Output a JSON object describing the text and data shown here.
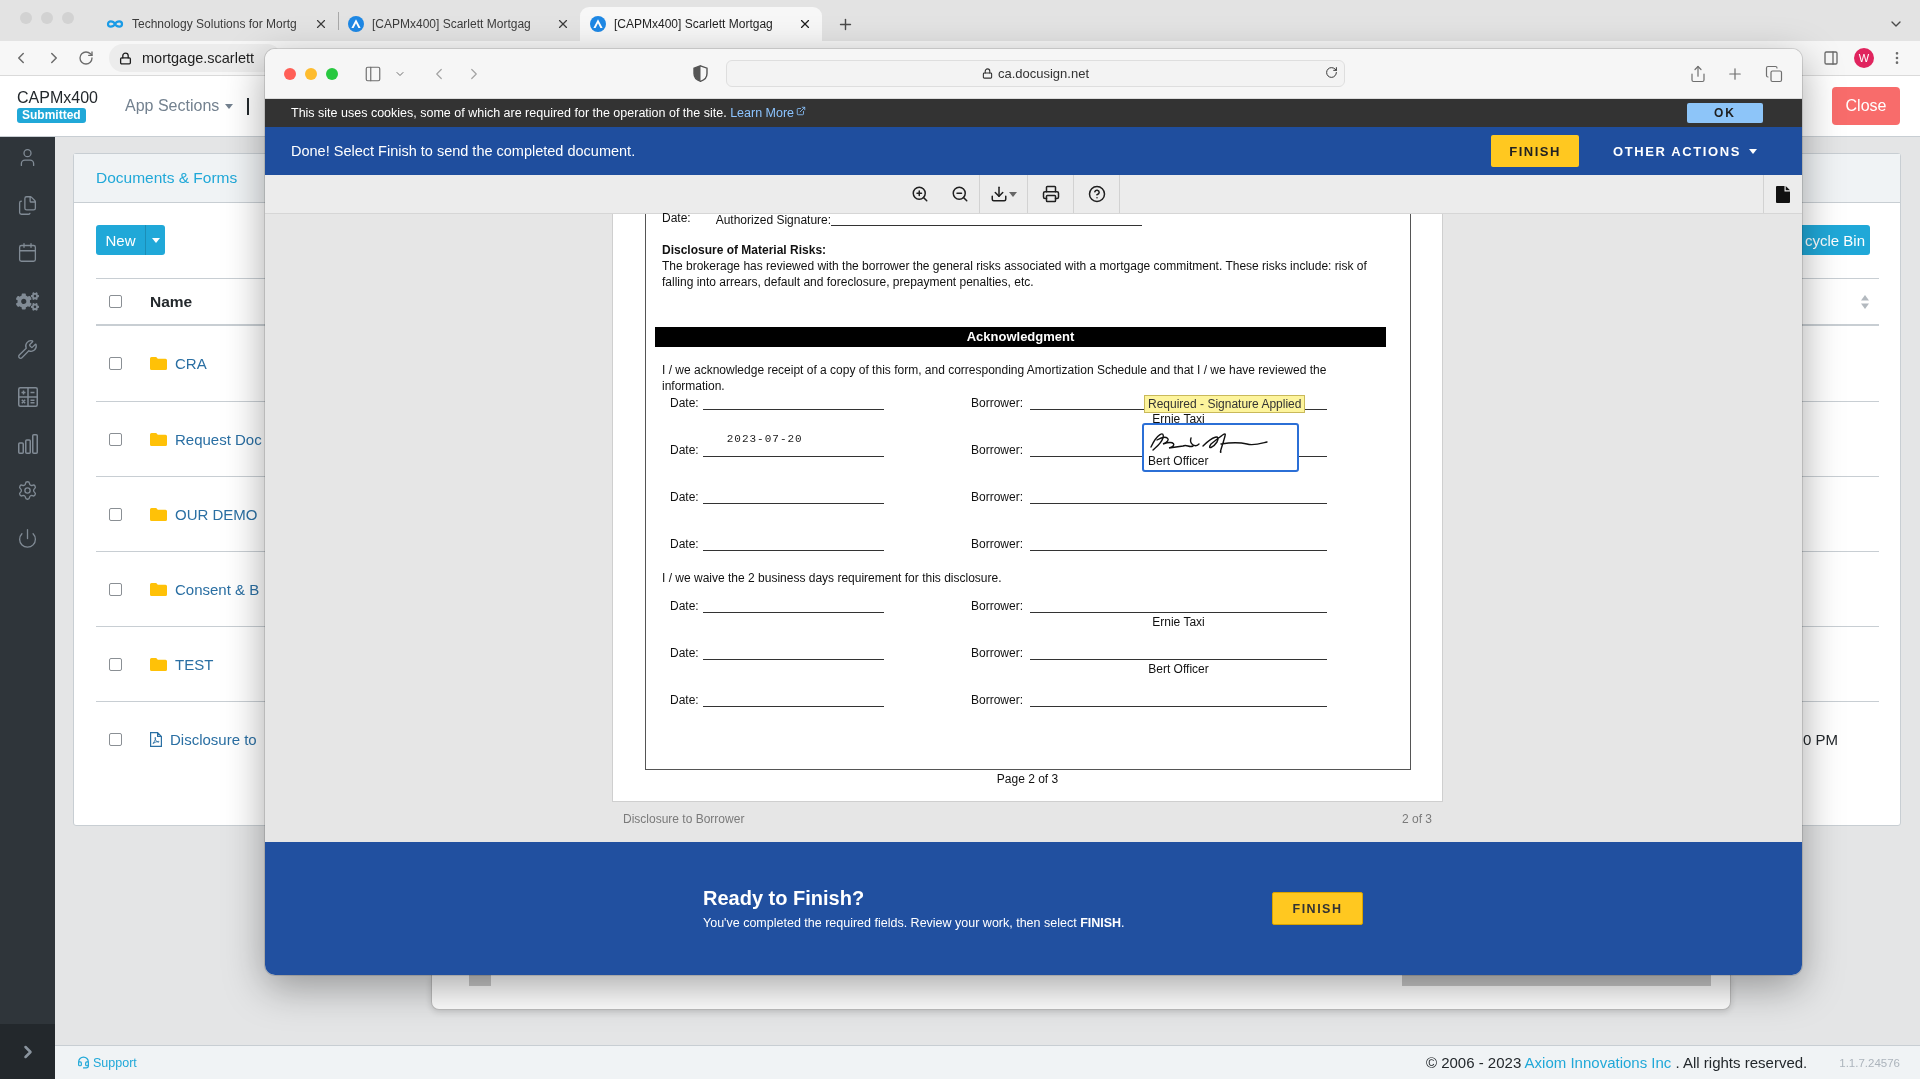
{
  "browser": {
    "tabs": [
      {
        "title": "Technology Solutions for Mortg",
        "kind": "site",
        "selected": false
      },
      {
        "title": "[CAPMx400] Scarlett Mortgag",
        "kind": "app",
        "selected": false
      },
      {
        "title": "[CAPMx400] Scarlett Mortgag",
        "kind": "app",
        "selected": true
      }
    ],
    "url": "mortgage.scarlett",
    "profile": "W"
  },
  "app": {
    "name": "CAPMx400",
    "status": "Submitted",
    "menu": "App Sections",
    "close_button": "Close",
    "panel": {
      "title": "Documents & Forms",
      "new_button": "New",
      "recycle_button": "cycle Bin",
      "table": {
        "all_checked": false,
        "columns": [
          "Name"
        ],
        "rows": [
          {
            "name": "CRA",
            "kind": "folder",
            "checked": false
          },
          {
            "name": "Request Doc",
            "kind": "folder",
            "checked": false
          },
          {
            "name": "OUR DEMO",
            "kind": "folder",
            "checked": false
          },
          {
            "name": "Consent & B",
            "kind": "folder",
            "checked": false
          },
          {
            "name": "TEST",
            "kind": "folder",
            "checked": false
          },
          {
            "name": "Disclosure to",
            "kind": "pdf",
            "checked": false,
            "modified": "0 PM"
          }
        ]
      }
    },
    "footer": {
      "support": "Support",
      "copyright": "© 2006 - 2023",
      "company": "Axiom Innovations Inc",
      "rights": ". All rights reserved.",
      "version": "1.1.7.24576"
    }
  },
  "signing_window": {
    "address": "ca.docusign.net",
    "cookie_notice": {
      "text": "This site uses cookies, some of which are required for the operation of the site.",
      "link": "Learn More",
      "button": "OK"
    },
    "action_bar": {
      "message": "Done! Select Finish to send the completed document.",
      "finish_button": "FINISH",
      "menu": "OTHER ACTIONS"
    },
    "document": {
      "top_line": {
        "date_label": "Date:",
        "signature_label": "Authorized Signature:"
      },
      "risks_title": "Disclosure of Material Risks:",
      "risks_text": "The brokerage has reviewed with the borrower the general risks associated with a mortgage commitment. These risks include: risk of falling into arrears, default and foreclosure, prepayment penalties, etc.",
      "banner": "Acknowledgment",
      "acknowledgment": "I / we acknowledge receipt of a copy of this form, and corresponding Amortization Schedule and that I / we have reviewed the information.",
      "acknowledgment_rows": [
        {
          "kind": "tagged",
          "date_label": "Date:",
          "borrower_label": "Borrower:",
          "tag": "Required - Signature Applied",
          "signer": "Ernie Taxi"
        },
        {
          "kind": "signed",
          "date_label": "Date:",
          "date_value": "2023-07-20",
          "borrower_label": "Borrower:",
          "signer": "Bert Officer"
        },
        {
          "kind": "blank",
          "date_label": "Date:",
          "borrower_label": "Borrower:"
        },
        {
          "kind": "blank",
          "date_label": "Date:",
          "borrower_label": "Borrower:"
        }
      ],
      "waiver": "I / we waive the 2 business days requirement for this disclosure.",
      "waiver_rows": [
        {
          "kind": "named",
          "date_label": "Date:",
          "borrower_label": "Borrower:",
          "signer": "Ernie Taxi"
        },
        {
          "kind": "named",
          "date_label": "Date:",
          "borrower_label": "Borrower:",
          "signer": "Bert Officer"
        },
        {
          "kind": "blank",
          "date_label": "Date:",
          "borrower_label": "Borrower:"
        }
      ],
      "page_label": "Page 2 of 3"
    },
    "document_name": "Disclosure to Borrower",
    "page_count": "2 of 3",
    "finish_panel": {
      "title": "Ready to Finish?",
      "text": "You've completed the required fields. Review your work, then select **FINISH**.",
      "button": "FINISH"
    }
  }
}
